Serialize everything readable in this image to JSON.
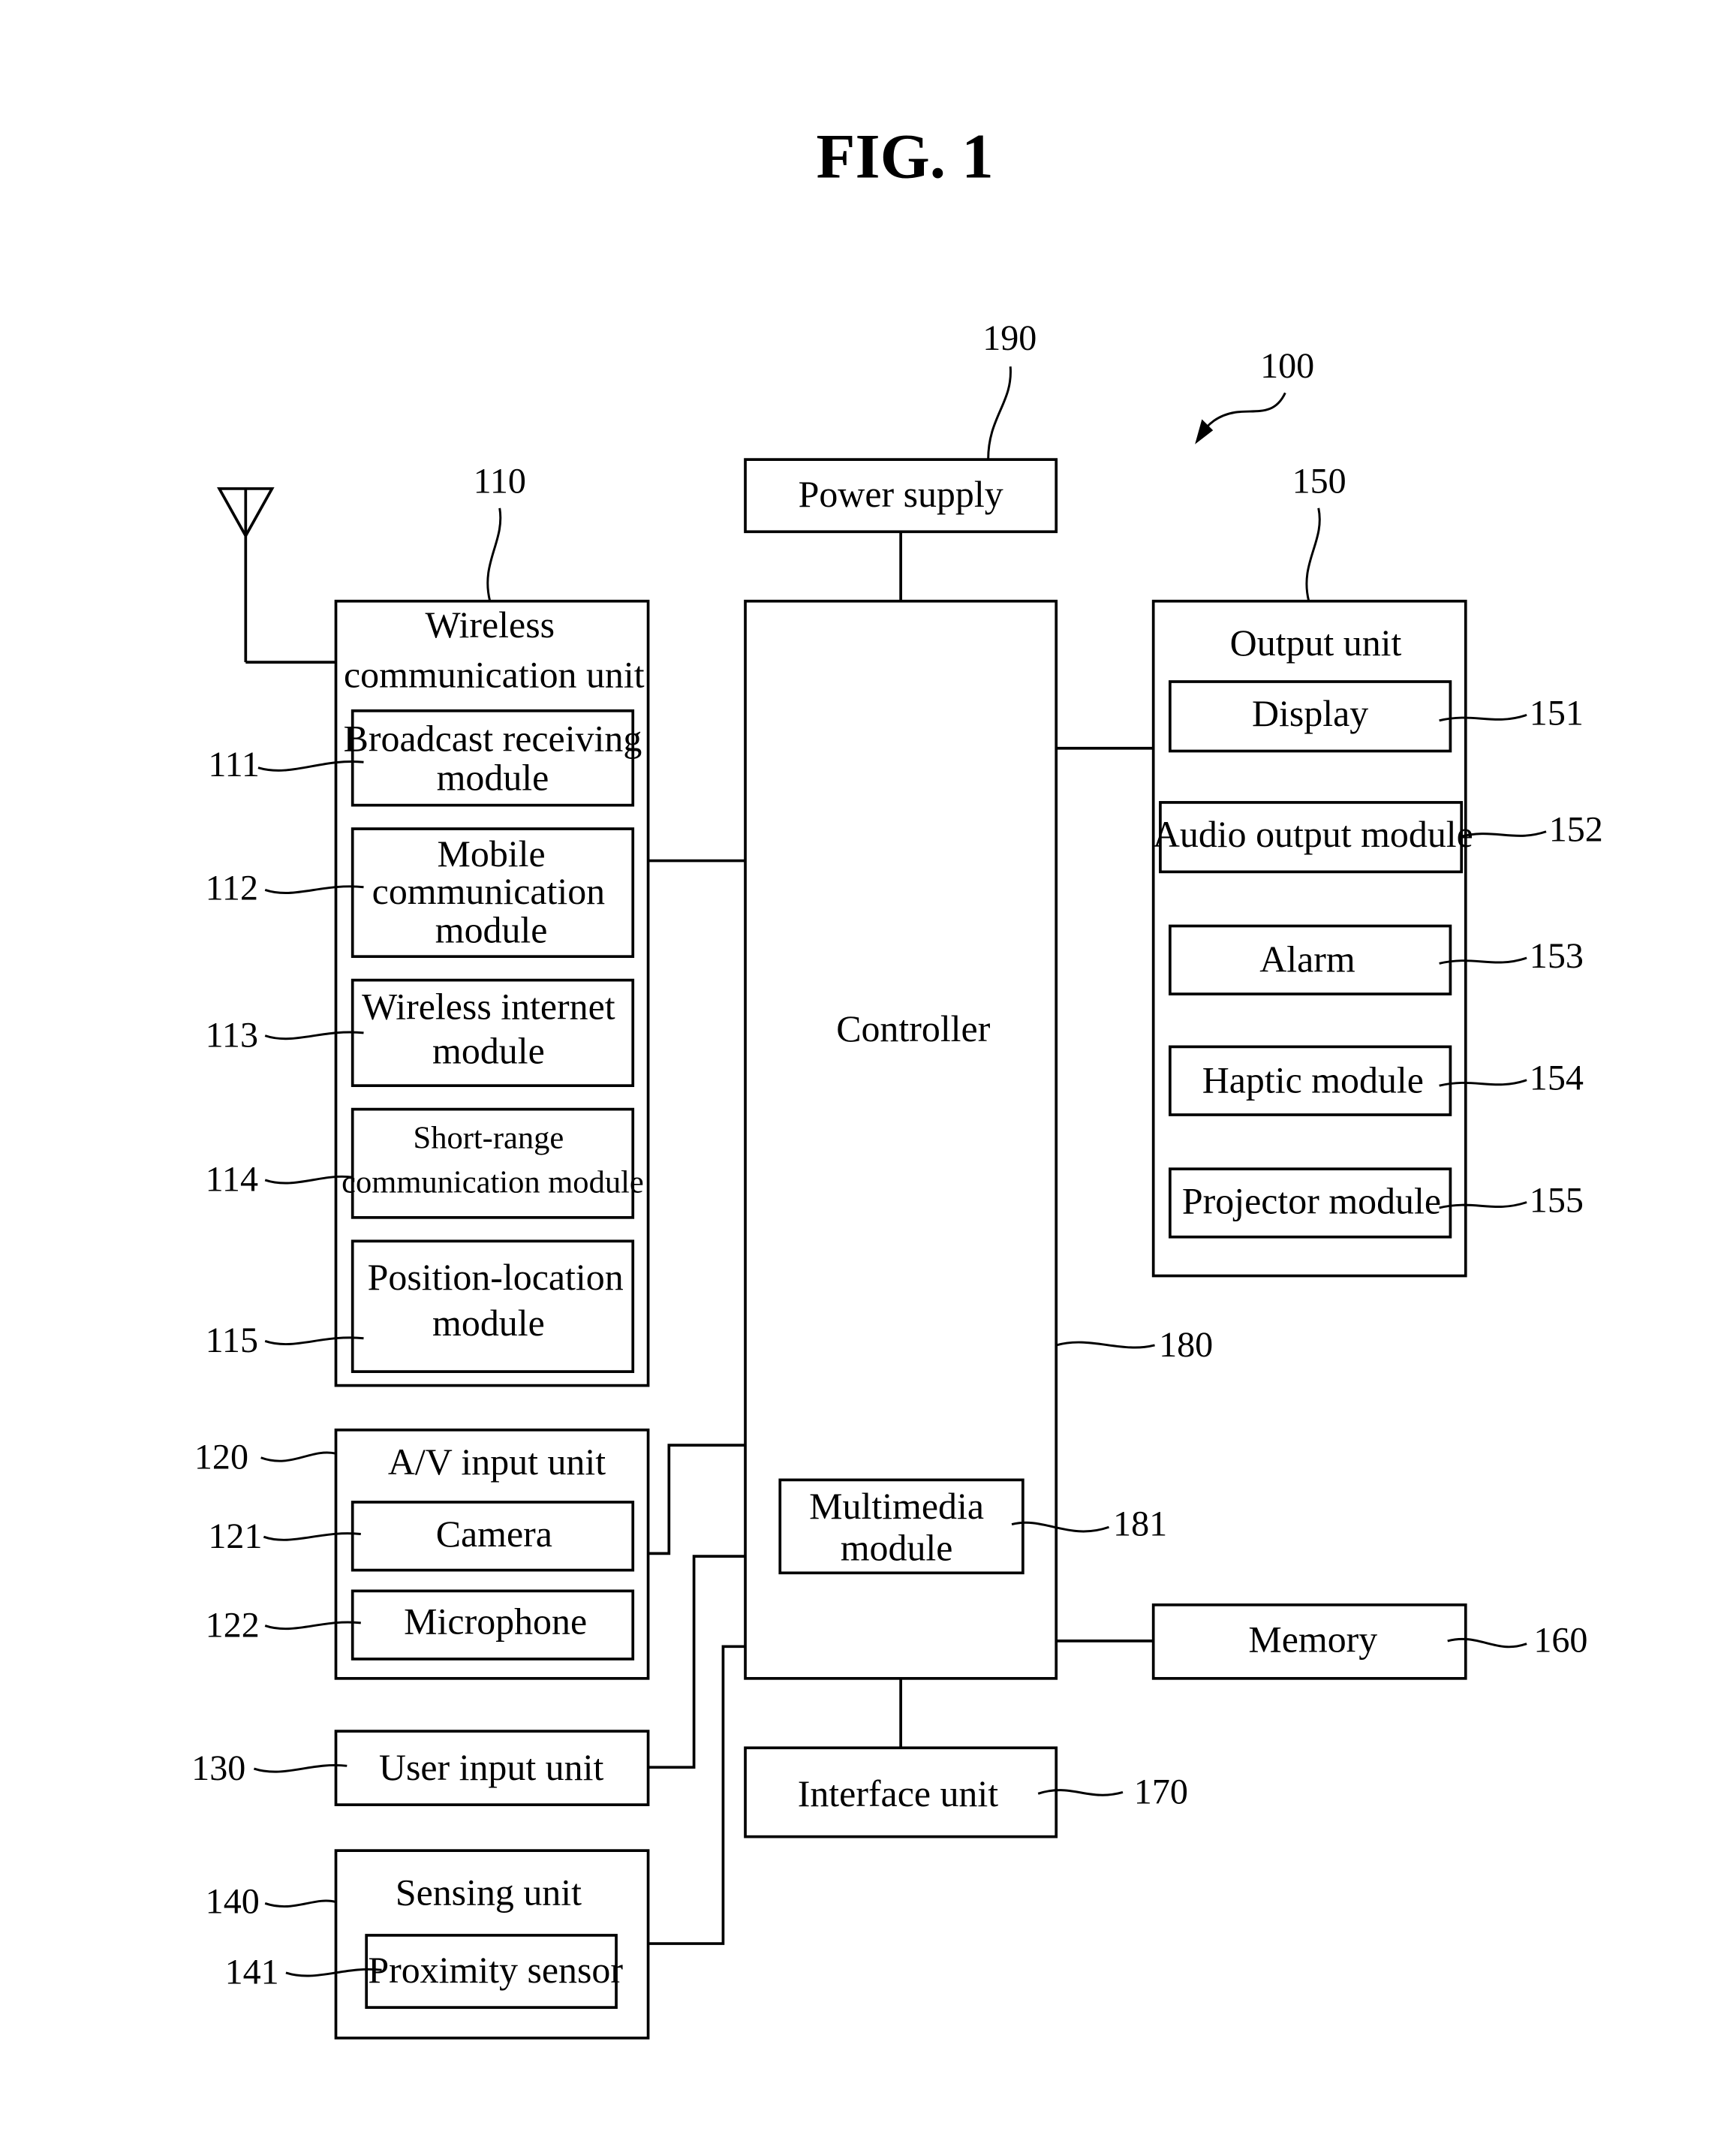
{
  "figure": {
    "title": "FIG. 1",
    "device_ref": "100"
  },
  "power_supply": {
    "ref": "190",
    "label": "Power supply"
  },
  "controller": {
    "ref": "180",
    "label": "Controller",
    "multimedia": {
      "ref": "181",
      "line1": "Multimedia",
      "line2": "module"
    }
  },
  "wireless_unit": {
    "ref": "110",
    "line1": "Wireless",
    "line2": "communication unit",
    "modules": [
      {
        "ref": "111",
        "line1": "Broadcast receiving",
        "line2": "module"
      },
      {
        "ref": "112",
        "line1": "Mobile",
        "line2": "communication",
        "line3": "module"
      },
      {
        "ref": "113",
        "line1": "Wireless internet",
        "line2": "module"
      },
      {
        "ref": "114",
        "line1": "Short-range",
        "line2": "communication module"
      },
      {
        "ref": "115",
        "line1": "Position-location",
        "line2": "module"
      }
    ]
  },
  "av_input_unit": {
    "ref": "120",
    "label": "A/V input unit",
    "modules": [
      {
        "ref": "121",
        "label": "Camera"
      },
      {
        "ref": "122",
        "label": "Microphone"
      }
    ]
  },
  "user_input_unit": {
    "ref": "130",
    "label": "User input unit"
  },
  "sensing_unit": {
    "ref": "140",
    "label": "Sensing unit",
    "modules": [
      {
        "ref": "141",
        "label": "Proximity sensor"
      }
    ]
  },
  "output_unit": {
    "ref": "150",
    "label": "Output unit",
    "modules": [
      {
        "ref": "151",
        "label": "Display"
      },
      {
        "ref": "152",
        "label": "Audio output module"
      },
      {
        "ref": "153",
        "label": "Alarm"
      },
      {
        "ref": "154",
        "label": "Haptic module"
      },
      {
        "ref": "155",
        "label": "Projector module"
      }
    ]
  },
  "memory": {
    "ref": "160",
    "label": "Memory"
  },
  "interface_unit": {
    "ref": "170",
    "label": "Interface unit"
  }
}
